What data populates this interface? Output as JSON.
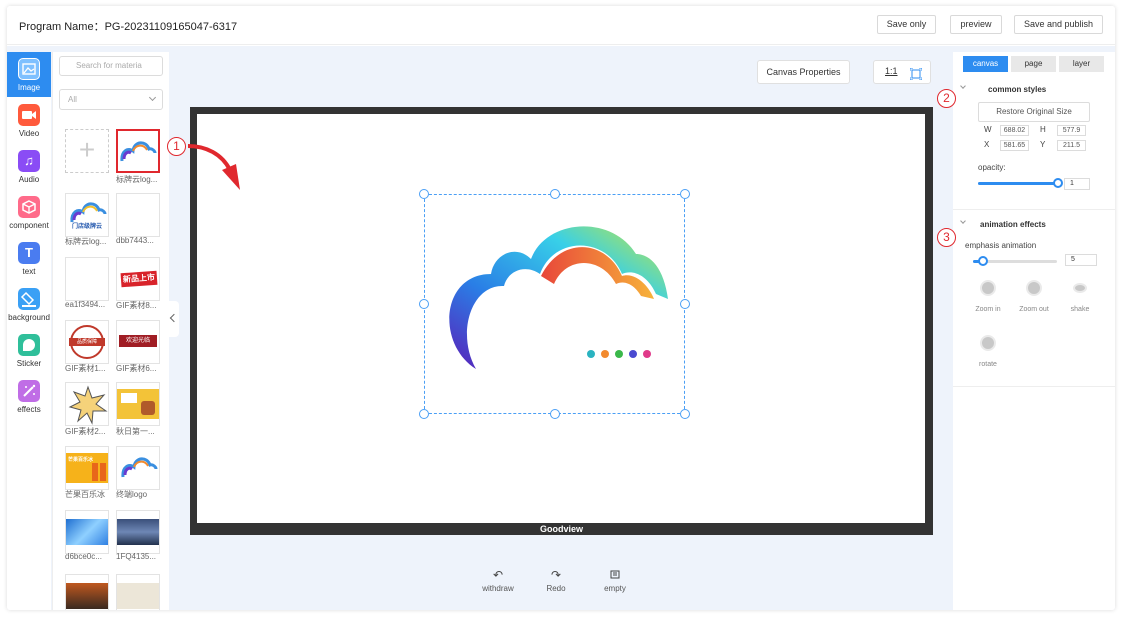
{
  "header": {
    "program_name": "Program Name：PG-20231109165047-6317",
    "buttons": {
      "save_only": "Save only",
      "preview": "preview",
      "save_publish": "Save and publish"
    }
  },
  "sidebar": {
    "items": [
      {
        "label": "Image",
        "icon": "image-icon",
        "color": "#2d8cf0"
      },
      {
        "label": "Video",
        "icon": "video-icon",
        "color": "#ff5a3c"
      },
      {
        "label": "Audio",
        "icon": "audio-icon",
        "color": "#8a4cf5"
      },
      {
        "label": "component",
        "icon": "component-icon",
        "color": "#ff6b8a"
      },
      {
        "label": "text",
        "icon": "text-icon",
        "color": "#4a7cf0"
      },
      {
        "label": "background",
        "icon": "background-icon",
        "color": "#3aa0f5"
      },
      {
        "label": "Sticker",
        "icon": "sticker-icon",
        "color": "#2fbf9a"
      },
      {
        "label": "effects",
        "icon": "effects-icon",
        "color": "#c06de6"
      }
    ]
  },
  "materials": {
    "search_placeholder": "Search for materia",
    "filter_value": "All",
    "items": [
      {
        "caption": ""
      },
      {
        "caption": "标牌云log..."
      },
      {
        "caption": "标牌云log..."
      },
      {
        "caption": "dbb7443..."
      },
      {
        "caption": "ea1f3494..."
      },
      {
        "caption": "GIF素材8..."
      },
      {
        "caption": "GIF素材1..."
      },
      {
        "caption": "GIF素材6..."
      },
      {
        "caption": "GIF素材2..."
      },
      {
        "caption": "秋日第一..."
      },
      {
        "caption": "芒果百乐冰"
      },
      {
        "caption": "终端logo"
      },
      {
        "caption": "d6bce0c..."
      },
      {
        "caption": "1FQ4135..."
      },
      {
        "caption": ""
      },
      {
        "caption": ""
      }
    ],
    "tile_texts": {
      "logo_text": "门店级牌云",
      "sale_text": "新品上市",
      "promo_text": "品质保障",
      "wine_text": "欢迎光临",
      "fruit_text": "芒果百乐冰"
    }
  },
  "canvas": {
    "properties_label": "Canvas Properties",
    "ratio_label": "1:1",
    "brand": "Goodview"
  },
  "toolbar": {
    "withdraw": "withdraw",
    "redo": "Redo",
    "empty": "empty"
  },
  "right_panel": {
    "tabs": [
      "canvas",
      "page",
      "layer"
    ],
    "common_styles": {
      "title": "common styles",
      "restore": "Restore Original Size",
      "w_label": "W",
      "w_value": "688.02",
      "h_label": "H",
      "h_value": "577.9",
      "x_label": "X",
      "x_value": "581.65",
      "y_label": "Y",
      "y_value": "211.5",
      "opacity_label": "opacity:",
      "opacity_value": "1",
      "opacity_fraction": 1.0
    },
    "animation": {
      "title": "animation effects",
      "emphasis_label": "emphasis animation",
      "emphasis_value": "5",
      "emphasis_fraction": 0.12,
      "effects": [
        "Zoom in",
        "Zoom out",
        "shake",
        "rotate"
      ]
    }
  },
  "annotations": {
    "m1": "1",
    "m2": "2",
    "m3": "3"
  }
}
